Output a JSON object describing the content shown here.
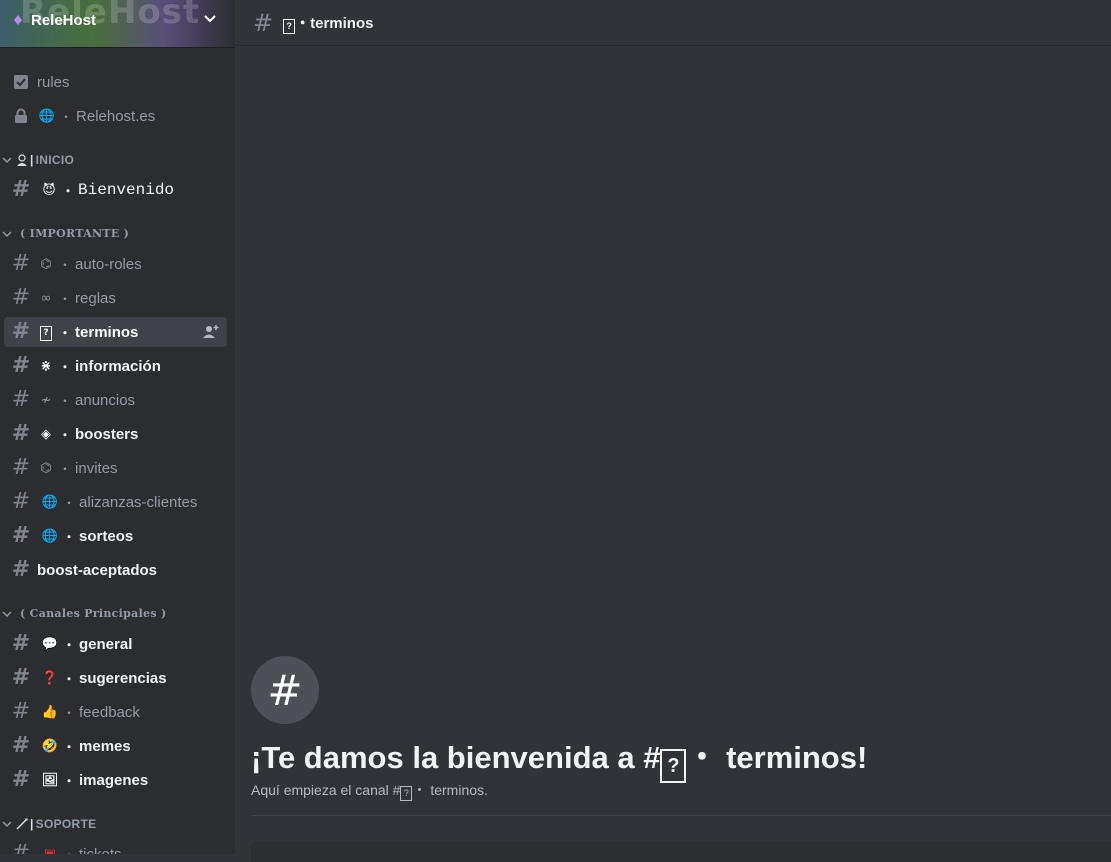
{
  "server": {
    "name": "ReleHost",
    "banner_text": "ReleHost"
  },
  "top_channels": [
    {
      "icon": "rules-icon",
      "label": "rules"
    },
    {
      "icon": "lock-icon",
      "emoji": "🌐",
      "label": "Relehost.es"
    }
  ],
  "categories": {
    "inicio": "INICIO",
    "importante": "( IMPORTANTE )",
    "principales": "( Canales Principales )",
    "soporte": "SOPORTE"
  },
  "channels": {
    "bienvenido": {
      "emoji": "😈",
      "label": "Bienvenido"
    },
    "auto_roles": {
      "emoji": "⌬",
      "label": "auto-roles"
    },
    "reglas": {
      "emoji": "∞",
      "label": "reglas"
    },
    "terminos": {
      "emoji": "?",
      "label": "terminos"
    },
    "informacion": {
      "emoji": "⋇",
      "label": "información"
    },
    "anuncios": {
      "emoji": "≁",
      "label": "anuncios"
    },
    "boosters": {
      "emoji": "◈",
      "label": "boosters"
    },
    "invites": {
      "emoji": "⌬",
      "label": "invites"
    },
    "alizanzas": {
      "emoji": "🌐",
      "label": "alizanzas-clientes"
    },
    "sorteos": {
      "emoji": "🌐",
      "label": "sorteos"
    },
    "boost_aceptados": {
      "label": "boost-aceptados"
    },
    "general": {
      "emoji": "💬",
      "label": "general"
    },
    "sugerencias": {
      "emoji": "❓",
      "label": "sugerencias"
    },
    "feedback": {
      "emoji": "👍",
      "label": "feedback"
    },
    "memes": {
      "emoji": "🤣",
      "label": "memes"
    },
    "imagenes": {
      "emoji": "🖼",
      "label": "imagenes"
    },
    "tickets": {
      "label": "tickets"
    }
  },
  "dot": "・",
  "header": {
    "title": "terminos"
  },
  "welcome": {
    "title_prefix": "¡Te damos la bienvenida a #",
    "title_suffix": " terminos!",
    "subtitle_prefix": "Aquí empieza el canal #",
    "subtitle_suffix": " terminos."
  }
}
